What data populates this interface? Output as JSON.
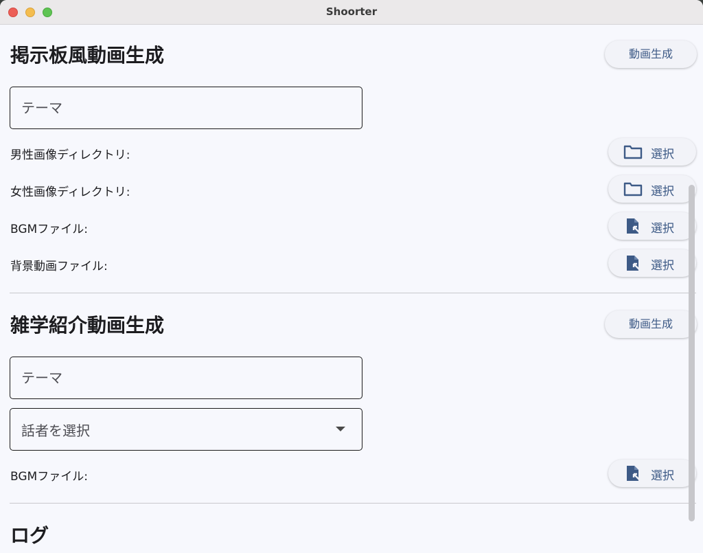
{
  "window": {
    "title": "Shoorter"
  },
  "section1": {
    "title": "掲示板風動画生成",
    "generate_label": "動画生成",
    "theme_placeholder": "テーマ",
    "rows": [
      {
        "label": "男性画像ディレクトリ:",
        "button": "選択",
        "icon": "folder-icon"
      },
      {
        "label": "女性画像ディレクトリ:",
        "button": "選択",
        "icon": "folder-icon"
      },
      {
        "label": "BGMファイル:",
        "button": "選択",
        "icon": "file-open-icon"
      },
      {
        "label": "背景動画ファイル:",
        "button": "選択",
        "icon": "file-open-icon"
      }
    ]
  },
  "section2": {
    "title": "雑学紹介動画生成",
    "generate_label": "動画生成",
    "theme_placeholder": "テーマ",
    "speaker_value": "話者を選択",
    "rows": [
      {
        "label": "BGMファイル:",
        "button": "選択",
        "icon": "file-open-icon"
      }
    ]
  },
  "section3": {
    "title": "ログ"
  },
  "colors": {
    "accent": "#3d5a86",
    "background": "#f7f8fd"
  }
}
